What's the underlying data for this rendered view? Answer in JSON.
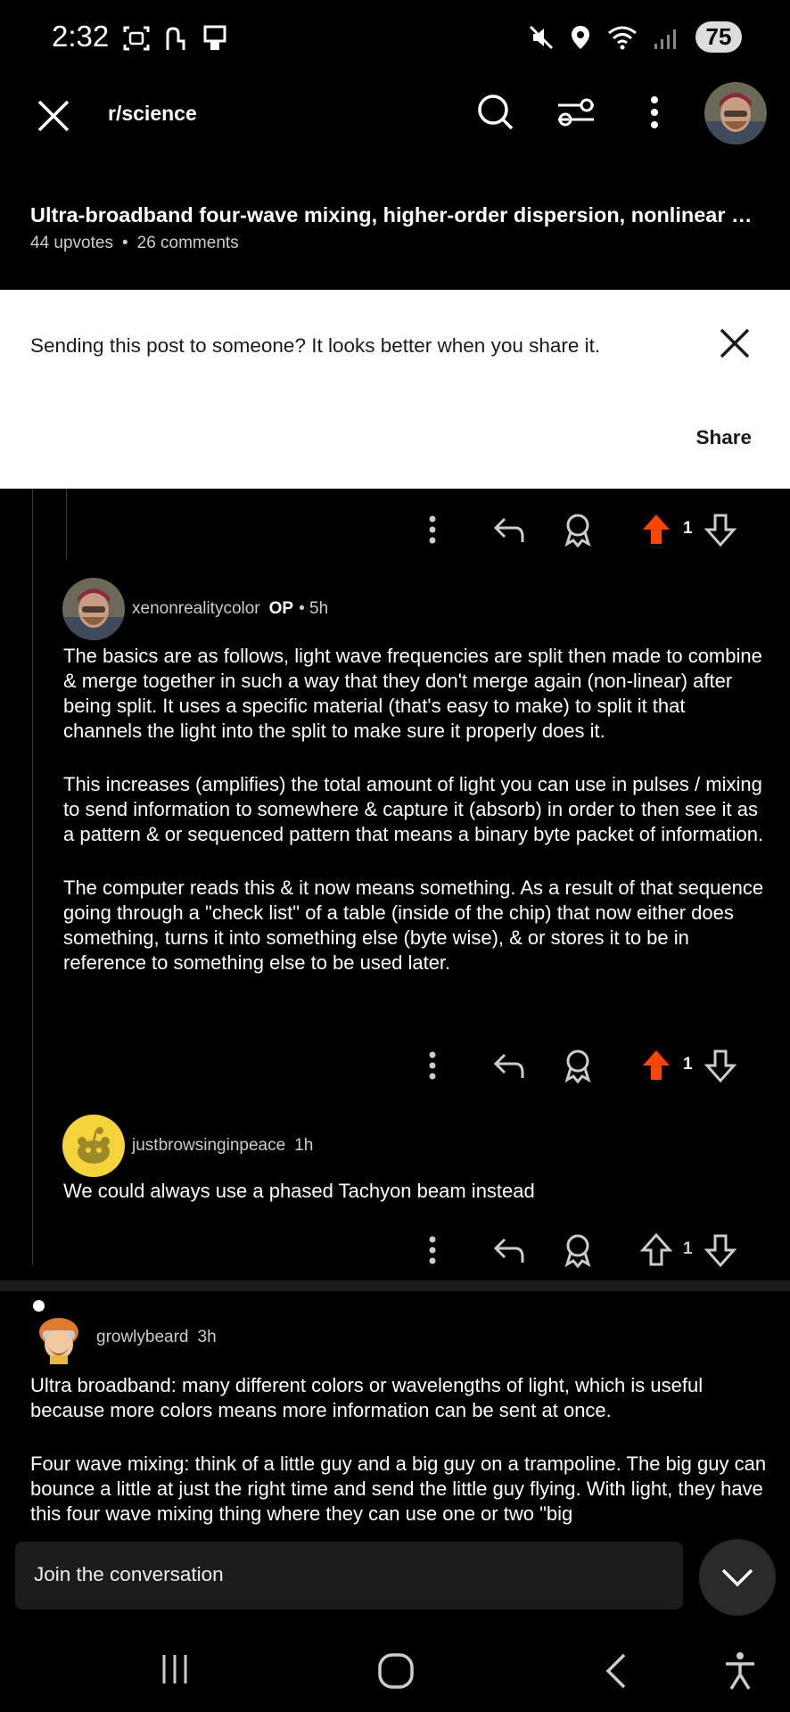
{
  "status": {
    "time": "2:32",
    "battery": "75"
  },
  "header": {
    "subreddit": "r/science"
  },
  "post": {
    "title": "Ultra-broadband four-wave mixing, higher-order dispersion, nonlinear opti...",
    "upvotes": "44 upvotes",
    "comments": "26 comments"
  },
  "share_banner": {
    "message": "Sending this post to someone? It looks better when you share it.",
    "share_label": "Share"
  },
  "comments": [
    {
      "votes": "1"
    },
    {
      "username": "xenonrealitycolor",
      "op_badge": "OP",
      "age": "• 5h",
      "paragraphs": [
        "The basics are as follows, light wave frequencies are split then made to combine & merge together in such a way that they don't merge again (non-linear) after being split. It uses a specific material (that's easy to make) to split it that channels the light into the split to make sure it properly does it.",
        "This increases (amplifies) the total amount of light you can use in pulses / mixing to send information to somewhere & capture it (absorb) in order to then see it as a pattern & or sequenced pattern that means a binary byte packet of information.",
        "The computer reads this & it now means something. As a result of that sequence going through a \"check list\" of a table (inside of the chip) that now either does something, turns it into something else (byte wise), & or stores it to be in reference to something else to be used later."
      ],
      "votes": "1"
    },
    {
      "username": "justbrowsinginpeace",
      "age": "1h",
      "paragraphs": [
        "We could always use a phased Tachyon beam instead"
      ],
      "votes": "1"
    },
    {
      "username": "growlybeard",
      "age": "3h",
      "paragraphs": [
        "Ultra broadband: many different colors or wavelengths of light, which is useful because more colors means more information can be sent at once.",
        "Four wave mixing: think of a little guy and a big guy on a trampoline. The big guy can bounce a little at just the right time and send the little guy flying. With light, they have this four wave mixing thing where they can use one or two \"big"
      ]
    }
  ],
  "composer": {
    "placeholder": "Join the conversation"
  },
  "colors": {
    "upvote_active": "#ff4500",
    "background": "#000000",
    "banner": "#ffffff"
  }
}
